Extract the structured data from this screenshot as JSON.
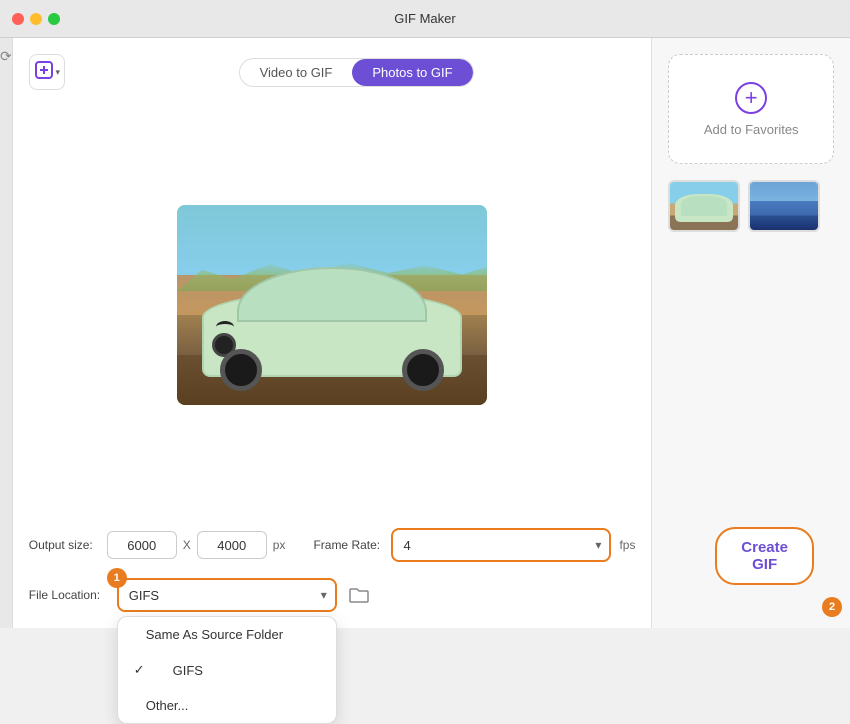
{
  "window": {
    "title": "GIF Maker"
  },
  "tabs": [
    {
      "id": "video-to-gif",
      "label": "Video to GIF",
      "active": false
    },
    {
      "id": "photos-to-gif",
      "label": "Photos to GIF",
      "active": true
    }
  ],
  "toolbar": {
    "add_icon": "⊕"
  },
  "favorites": {
    "plus_icon": "+",
    "label": "Add to Favorites"
  },
  "output_size": {
    "label": "Output size:",
    "width": "6000",
    "x_separator": "X",
    "height": "4000",
    "unit": "px"
  },
  "frame_rate": {
    "label": "Frame Rate:",
    "value": "4",
    "unit": "fps"
  },
  "file_location": {
    "label": "File Location:",
    "selected": "GIFS",
    "badge": "1",
    "options": [
      {
        "value": "same-as-source",
        "label": "Same As Source Folder",
        "checked": false
      },
      {
        "value": "gifs",
        "label": "GIFS",
        "checked": true
      },
      {
        "value": "other",
        "label": "Other...",
        "checked": false
      }
    ]
  },
  "create_btn": {
    "label": "Create GIF",
    "badge": "2"
  },
  "sidebar": {
    "icon": "⟳"
  }
}
